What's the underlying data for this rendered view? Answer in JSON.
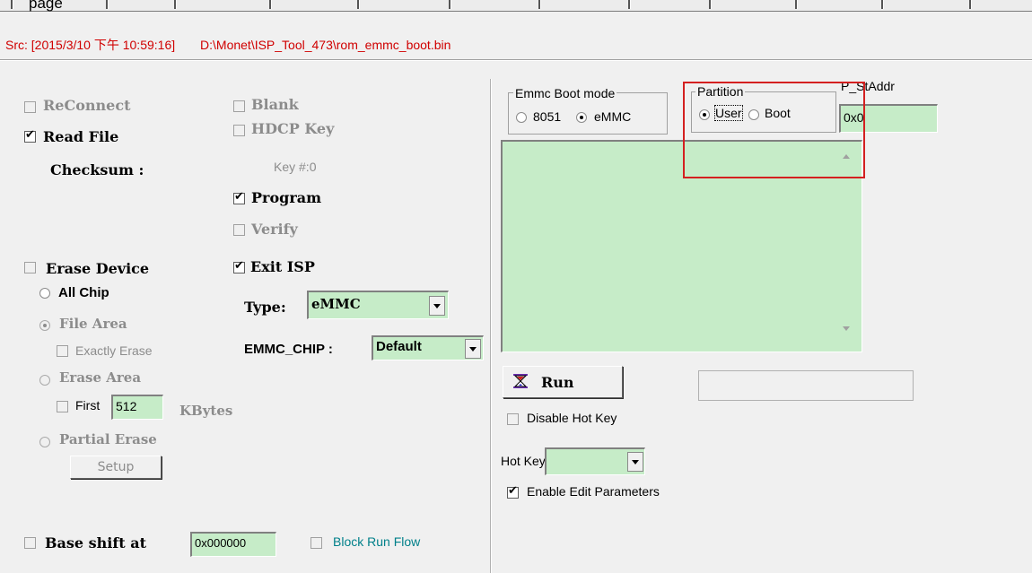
{
  "toolbar": {
    "page_label": "page"
  },
  "source": {
    "timestamp": "Src: [2015/3/10 下午 10:59:16]",
    "path": "D:\\Monet\\ISP_Tool_473\\rom_emmc_boot.bin"
  },
  "left": {
    "reconnect": "ReConnect",
    "read_file": "Read File",
    "checksum": "Checksum :",
    "erase_device": "Erase Device",
    "all_chip": "All Chip",
    "file_area": "File Area",
    "exactly_erase": "Exactly Erase",
    "erase_area": "Erase Area",
    "first_label": "First",
    "first_value": "512",
    "kbytes": "KBytes",
    "partial_erase": "Partial Erase",
    "setup": "Setup",
    "base_shift": "Base shift at",
    "base_shift_value": "0x000000",
    "block_run_flow": "Block Run Flow"
  },
  "middle": {
    "blank": "Blank",
    "hdcp_key": "HDCP Key",
    "key_num": "Key #:0",
    "program": "Program",
    "verify": "Verify",
    "exit_isp": "Exit ISP",
    "type_label": "Type:",
    "type_value": "eMMC",
    "emmc_chip_label": "EMMC_CHIP :",
    "emmc_chip_value": "Default"
  },
  "right": {
    "boot_mode_title": "Emmc Boot mode",
    "boot_8051": "8051",
    "boot_emmc": "eMMC",
    "partition_title": "Partition",
    "partition_user": "User",
    "partition_boot": "Boot",
    "p_staddr_label": "P_StAddr",
    "p_staddr_value": "0x0",
    "run": "Run",
    "disable_hot_key": "Disable Hot Key",
    "hot_key_label": "Hot Key",
    "enable_edit": "Enable Edit Parameters"
  },
  "colors": {
    "field_green": "#c6ecc8",
    "source_red": "#d00000",
    "annotation_red": "#d42020",
    "link_teal": "#00808a"
  }
}
